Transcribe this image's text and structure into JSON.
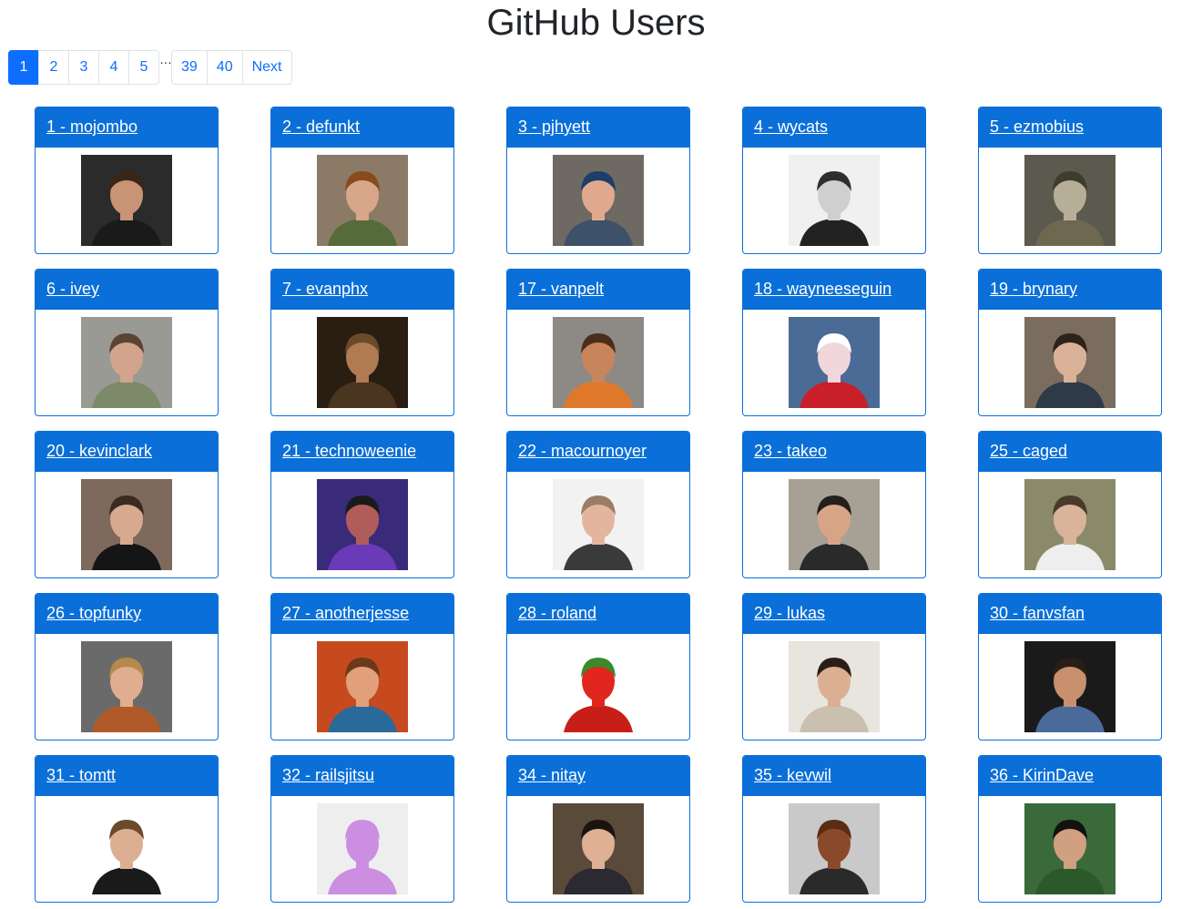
{
  "page": {
    "title": "GitHub Users"
  },
  "pagination": {
    "pages": [
      "1",
      "2",
      "3",
      "4",
      "5"
    ],
    "ellipsis": "…",
    "tail_pages": [
      "39",
      "40"
    ],
    "next_label": "Next",
    "active": "1"
  },
  "users": [
    {
      "label": "1 - mojombo",
      "bg": "#2b2b2b",
      "skin": "#c99474",
      "hair": "#3a2618",
      "shirt": "#1a1a1a"
    },
    {
      "label": "2 - defunkt",
      "bg": "#8a7a66",
      "skin": "#d8a68a",
      "hair": "#8a4a1c",
      "shirt": "#556b3a"
    },
    {
      "label": "3 - pjhyett",
      "bg": "#6e6a63",
      "skin": "#e0a98e",
      "hair": "#1d3d6b",
      "shirt": "#3d5168"
    },
    {
      "label": "4 - wycats",
      "bg": "#f0f0f0",
      "skin": "#cfcfcf",
      "hair": "#2e2e2e",
      "shirt": "#222222"
    },
    {
      "label": "5 - ezmobius",
      "bg": "#5c5a4e",
      "skin": "#b7ae97",
      "hair": "#3f3b2f",
      "shirt": "#6f6850"
    },
    {
      "label": "6 - ivey",
      "bg": "#9a9a94",
      "skin": "#d2a48c",
      "hair": "#5a4530",
      "shirt": "#7d8a6a"
    },
    {
      "label": "7 - evanphx",
      "bg": "#2a1d12",
      "skin": "#b07a52",
      "hair": "#6b4a2a",
      "shirt": "#4a3520"
    },
    {
      "label": "17 - vanpelt",
      "bg": "#8d8a86",
      "skin": "#c8845a",
      "hair": "#4a2e1c",
      "shirt": "#e0782c"
    },
    {
      "label": "18 - wayneeseguin",
      "bg": "#4a6b96",
      "skin": "#f1d6dc",
      "hair": "#ffffff",
      "shirt": "#c81f2b"
    },
    {
      "label": "19 - brynary",
      "bg": "#7a6d60",
      "skin": "#d9b197",
      "hair": "#2d231a",
      "shirt": "#2f3a48"
    },
    {
      "label": "20 - kevinclark",
      "bg": "#7d6a5c",
      "skin": "#d7a98f",
      "hair": "#3a2a1f",
      "shirt": "#151515"
    },
    {
      "label": "21 - technoweenie",
      "bg": "#3a2a7a",
      "skin": "#b05c5a",
      "hair": "#1a1a1a",
      "shirt": "#6a3ab8"
    },
    {
      "label": "22 - macournoyer",
      "bg": "#f2f2f2",
      "skin": "#e4b59e",
      "hair": "#9a7d66",
      "shirt": "#3a3a3a"
    },
    {
      "label": "23 - takeo",
      "bg": "#a7a195",
      "skin": "#d8a486",
      "hair": "#232019",
      "shirt": "#2a2a2a"
    },
    {
      "label": "25 - caged",
      "bg": "#8a8a6a",
      "skin": "#d9b49a",
      "hair": "#4a3a2a",
      "shirt": "#eeeeee"
    },
    {
      "label": "26 - topfunky",
      "bg": "#6a6a6a",
      "skin": "#e0ad90",
      "hair": "#b58a4a",
      "shirt": "#b05a2a"
    },
    {
      "label": "27 - anotherjesse",
      "bg": "#c64a1e",
      "skin": "#e2a07a",
      "hair": "#6a3a1a",
      "shirt": "#2a6a9a"
    },
    {
      "label": "28 - roland",
      "bg": "#ffffff",
      "skin": "#e0261e",
      "hair": "#3a8a2a",
      "shirt": "#c81e18"
    },
    {
      "label": "29 - lukas",
      "bg": "#e8e4de",
      "skin": "#dcae92",
      "hair": "#2a1e16",
      "shirt": "#c9c0b0"
    },
    {
      "label": "30 - fanvsfan",
      "bg": "#1a1a1a",
      "skin": "#c8906e",
      "hair": "#2a1e16",
      "shirt": "#4a6a9a"
    },
    {
      "label": "31 - tomtt",
      "bg": "#ffffff",
      "skin": "#dcae92",
      "hair": "#6a4a2a",
      "shirt": "#1a1a1a"
    },
    {
      "label": "32 - railsjitsu",
      "bg": "#eeeeee",
      "skin": "#cc8ee0",
      "hair": "#cc8ee0",
      "shirt": "#cc8ee0"
    },
    {
      "label": "34 - nitay",
      "bg": "#5a4a3a",
      "skin": "#e0b095",
      "hair": "#1a1410",
      "shirt": "#2a2a30"
    },
    {
      "label": "35 - kevwil",
      "bg": "#c9c9c9",
      "skin": "#8a4a2a",
      "hair": "#5a2e14",
      "shirt": "#2a2a2a"
    },
    {
      "label": "36 - KirinDave",
      "bg": "#3a6a3a",
      "skin": "#d0a080",
      "hair": "#121212",
      "shirt": "#2a5a2a"
    }
  ]
}
